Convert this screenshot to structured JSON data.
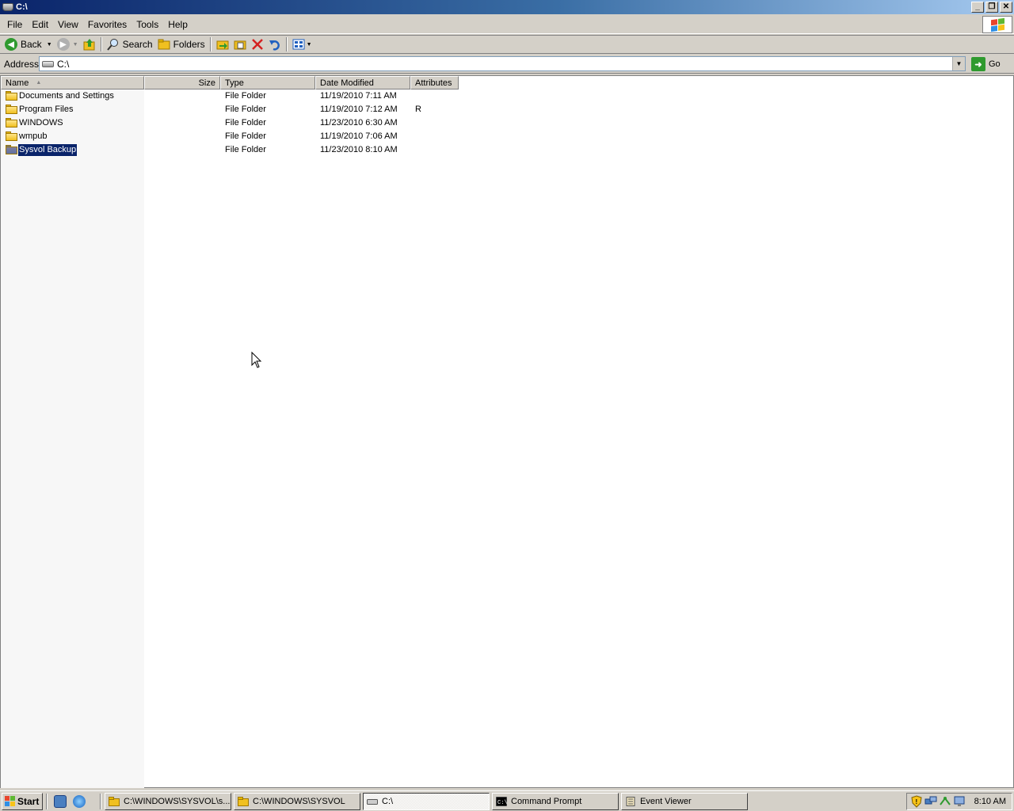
{
  "window": {
    "title": "C:\\"
  },
  "menu": [
    {
      "label": "File"
    },
    {
      "label": "Edit"
    },
    {
      "label": "View"
    },
    {
      "label": "Favorites"
    },
    {
      "label": "Tools"
    },
    {
      "label": "Help"
    }
  ],
  "toolbar": {
    "back_label": "Back",
    "search_label": "Search",
    "folders_label": "Folders"
  },
  "address": {
    "label": "Address",
    "value": "C:\\",
    "go_label": "Go"
  },
  "columns": {
    "name": "Name",
    "size": "Size",
    "type": "Type",
    "date": "Date Modified",
    "attributes": "Attributes"
  },
  "rows": [
    {
      "name": "Documents and Settings",
      "size": "",
      "type": "File Folder",
      "date": "11/19/2010 7:11 AM",
      "attributes": ""
    },
    {
      "name": "Program Files",
      "size": "",
      "type": "File Folder",
      "date": "11/19/2010 7:12 AM",
      "attributes": "R"
    },
    {
      "name": "WINDOWS",
      "size": "",
      "type": "File Folder",
      "date": "11/23/2010 6:30 AM",
      "attributes": ""
    },
    {
      "name": "wmpub",
      "size": "",
      "type": "File Folder",
      "date": "11/19/2010 7:06 AM",
      "attributes": ""
    },
    {
      "name": "Sysvol Backup",
      "size": "",
      "type": "File Folder",
      "date": "11/23/2010 8:10 AM",
      "attributes": "",
      "selected": true
    }
  ],
  "taskbar": {
    "start_label": "Start",
    "tasks": [
      {
        "label": "C:\\WINDOWS\\SYSVOL\\s...",
        "icon": "folder-icon"
      },
      {
        "label": "C:\\WINDOWS\\SYSVOL",
        "icon": "folder-icon"
      },
      {
        "label": "C:\\",
        "icon": "drive-icon",
        "active": true
      },
      {
        "label": "Command Prompt",
        "icon": "cmd-icon"
      },
      {
        "label": "Event Viewer",
        "icon": "event-viewer-icon"
      }
    ],
    "clock": "8:10 AM"
  },
  "colors": {
    "title_start": "#0a246a",
    "title_end": "#a6caf0",
    "selection": "#0a246a",
    "chrome": "#d4d0c8"
  }
}
